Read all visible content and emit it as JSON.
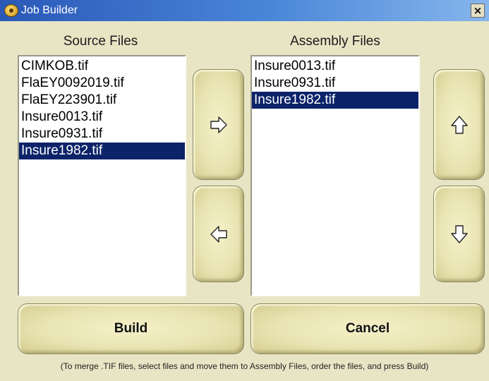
{
  "window": {
    "title": "Job Builder",
    "close_label": "×"
  },
  "source": {
    "header": "Source Files",
    "items": [
      "CIMKOB.tif",
      "FlaEY0092019.tif",
      "FlaEY223901.tif",
      "Insure0013.tif",
      "Insure0931.tif",
      "Insure1982.tif"
    ],
    "selected": "Insure1982.tif"
  },
  "assembly": {
    "header": "Assembly Files",
    "items": [
      "Insure0013.tif",
      "Insure0931.tif",
      "Insure1982.tif"
    ],
    "selected": "Insure1982.tif"
  },
  "buttons": {
    "move_right_icon": "arrow-right-icon",
    "move_left_icon": "arrow-left-icon",
    "move_up_icon": "arrow-up-icon",
    "move_down_icon": "arrow-down-icon",
    "build_label": "Build",
    "cancel_label": "Cancel"
  },
  "footer": {
    "hint": "(To merge .TIF files, select files and move them to Assembly Files, order the files, and press Build)"
  },
  "colors": {
    "selection": "#0c2369",
    "background": "#e8e5c5",
    "titlebar": "#2a58b8"
  }
}
